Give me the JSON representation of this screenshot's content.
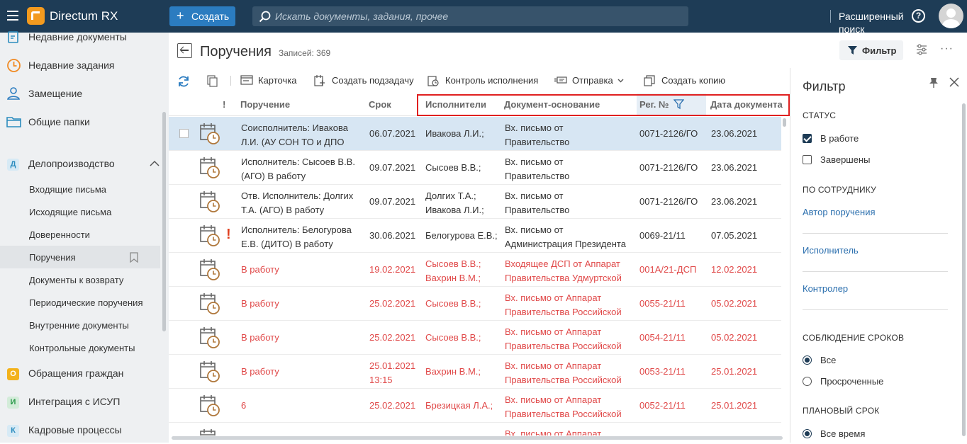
{
  "app": {
    "name": "Directum RX"
  },
  "header": {
    "create_label": "Создать",
    "search_placeholder": "Искать документы, задания, прочее",
    "advanced_search": "Расширенный поиск",
    "help": "?"
  },
  "sidebar": {
    "top_items": [
      {
        "label": "Недавние документы",
        "icon": "documents-icon"
      },
      {
        "label": "Недавние задания",
        "icon": "clock-icon"
      },
      {
        "label": "Замещение",
        "icon": "user-icon"
      },
      {
        "label": "Общие папки",
        "icon": "folder-icon"
      }
    ],
    "sections": [
      {
        "badge": "Д",
        "label": "Делопроизводство",
        "color": "#2b8cbe",
        "bg": "#d7eaf5"
      },
      {
        "badge": "О",
        "label": "Обращения граждан",
        "color": "#ffffff",
        "bg": "#f3b21b"
      },
      {
        "badge": "И",
        "label": "Интеграция с ИСУП",
        "color": "#2a9a4a",
        "bg": "#d3ecd9"
      },
      {
        "badge": "К",
        "label": "Кадровые процессы",
        "color": "#2b8cbe",
        "bg": "#d7eaf5"
      }
    ],
    "sub_items": [
      "Входящие письма",
      "Исходящие письма",
      "Доверенности",
      "Поручения",
      "Документы к возврату",
      "Периодические поручения",
      "Внутренние документы",
      "Контрольные документы"
    ]
  },
  "main": {
    "title": "Поручения",
    "count": "Записей: 369",
    "filter_button": "Фильтр",
    "toolbar": {
      "card": "Карточка",
      "subtask": "Создать подзадачу",
      "control": "Контроль исполнения",
      "send": "Отправка",
      "copy": "Создать копию"
    },
    "columns": {
      "importance": "!",
      "task": "Поручение",
      "deadline": "Срок",
      "performers": "Исполнители",
      "base_doc": "Документ-основание",
      "reg_no": "Рег. №",
      "doc_date": "Дата документа"
    },
    "rows": [
      {
        "important": false,
        "overdue": false,
        "task": [
          "Соисполнитель: Ивакова",
          "Л.И. (АУ СОН ТО и ДПО"
        ],
        "deadline": [
          "06.07.2021"
        ],
        "performers": [
          "Ивакова Л.И.;"
        ],
        "base_doc": [
          "Вх. письмо от",
          "Правительство"
        ],
        "reg_no": "0071-2126/ГО",
        "doc_date": "23.06.2021"
      },
      {
        "important": false,
        "overdue": false,
        "task": [
          "Исполнитель: Сысоев В.В.",
          "(АГО) В работу"
        ],
        "deadline": [
          "09.07.2021"
        ],
        "performers": [
          "Сысоев В.В.;"
        ],
        "base_doc": [
          "Вх. письмо от",
          "Правительство"
        ],
        "reg_no": "0071-2126/ГО",
        "doc_date": "23.06.2021"
      },
      {
        "important": false,
        "overdue": false,
        "task": [
          "Отв. Исполнитель: Долгих",
          "Т.А. (АГО) В работу"
        ],
        "deadline": [
          "09.07.2021"
        ],
        "performers": [
          "Долгих Т.А.;",
          "Ивакова Л.И.;"
        ],
        "base_doc": [
          "Вх. письмо от",
          "Правительство"
        ],
        "reg_no": "0071-2126/ГО",
        "doc_date": "23.06.2021"
      },
      {
        "important": true,
        "overdue": false,
        "task": [
          "Исполнитель: Белогурова",
          "Е.В. (ДИТО) В работу"
        ],
        "deadline": [
          "30.06.2021"
        ],
        "performers": [
          "Белогурова Е.В.;"
        ],
        "base_doc": [
          "Вх. письмо от",
          "Администрация Президента"
        ],
        "reg_no": "0069-21/11",
        "doc_date": "07.05.2021"
      },
      {
        "important": false,
        "overdue": true,
        "task": [
          "В работу"
        ],
        "deadline": [
          "19.02.2021"
        ],
        "performers": [
          "Сысоев В.В.;",
          "Вахрин В.М.;"
        ],
        "base_doc": [
          "Входящее ДСП от Аппарат",
          "Правительства Удмуртской"
        ],
        "reg_no": "001А/21-ДСП",
        "doc_date": "12.02.2021"
      },
      {
        "important": false,
        "overdue": true,
        "task": [
          "В работу"
        ],
        "deadline": [
          "25.02.2021"
        ],
        "performers": [
          "Сысоев В.В.;"
        ],
        "base_doc": [
          "Вх. письмо от Аппарат",
          "Правительства Российской"
        ],
        "reg_no": "0055-21/11",
        "doc_date": "05.02.2021"
      },
      {
        "important": false,
        "overdue": true,
        "task": [
          "В работу"
        ],
        "deadline": [
          "25.02.2021"
        ],
        "performers": [
          "Сысоев В.В.;"
        ],
        "base_doc": [
          "Вх. письмо от Аппарат",
          "Правительства Российской"
        ],
        "reg_no": "0054-21/11",
        "doc_date": "05.02.2021"
      },
      {
        "important": false,
        "overdue": true,
        "task": [
          "В работу"
        ],
        "deadline": [
          "25.01.2021",
          "13:15"
        ],
        "performers": [
          "Вахрин В.М.;"
        ],
        "base_doc": [
          "Вх. письмо от Аппарат",
          "Правительства Российской"
        ],
        "reg_no": "0053-21/11",
        "doc_date": "25.01.2021"
      },
      {
        "important": false,
        "overdue": true,
        "task": [
          "6"
        ],
        "deadline": [
          "25.02.2021"
        ],
        "performers": [
          "Брезицкая Л.А.;"
        ],
        "base_doc": [
          "Вх. письмо от Аппарат",
          "Правительства Российской"
        ],
        "reg_no": "0052-21/11",
        "doc_date": "25.01.2021"
      },
      {
        "important": false,
        "overdue": true,
        "task": [
          ""
        ],
        "deadline": [
          ""
        ],
        "performers": [
          ""
        ],
        "base_doc": [
          "Вх. письмо от Аппарат",
          ""
        ],
        "reg_no": "",
        "doc_date": ""
      }
    ]
  },
  "filter": {
    "title": "Фильтр",
    "status_title": "СТАТУС",
    "status_in_work": "В работе",
    "status_done": "Завершены",
    "employee_title": "ПО СОТРУДНИКУ",
    "author": "Автор поручения",
    "performer": "Исполнитель",
    "controller": "Контролер",
    "deadline_title": "СОБЛЮДЕНИЕ СРОКОВ",
    "deadline_all": "Все",
    "deadline_overdue": "Просроченные",
    "planned_title": "ПЛАНОВЫЙ СРОК",
    "planned_all": "Все время"
  },
  "colors": {
    "topbar": "#1e3c56",
    "accent": "#2b7cc0",
    "overdue": "#e04848",
    "highlight_box": "#e02020",
    "selected_row": "#d7e6f3"
  }
}
